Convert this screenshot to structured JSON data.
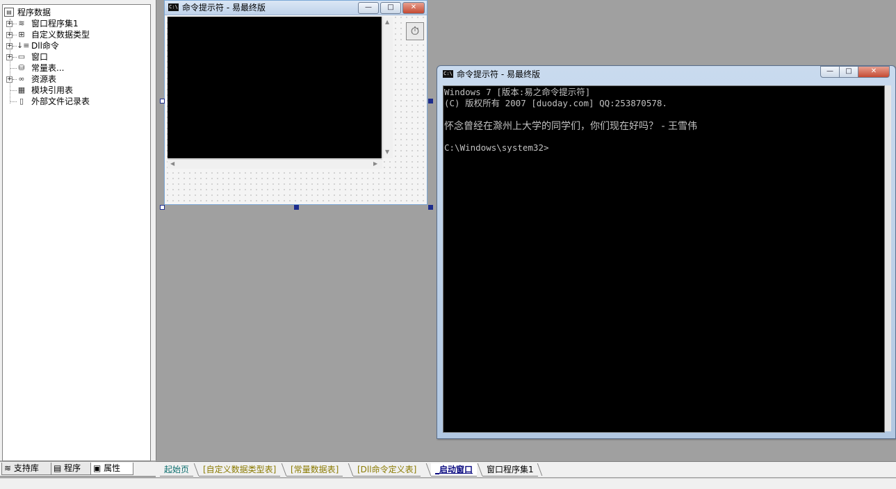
{
  "tree": {
    "root": "程序数据",
    "items": [
      {
        "label": "窗口程序集1",
        "icon": "stack-icon",
        "expandable": true
      },
      {
        "label": "自定义数据类型",
        "icon": "datatype-icon",
        "expandable": true
      },
      {
        "label": "Dll命令",
        "icon": "dll-icon",
        "expandable": true
      },
      {
        "label": "窗口",
        "icon": "window-icon",
        "expandable": true
      },
      {
        "label": "常量表...",
        "icon": "database-icon",
        "expandable": false
      },
      {
        "label": "资源表",
        "icon": "resource-icon",
        "expandable": true
      },
      {
        "label": "模块引用表",
        "icon": "module-icon",
        "expandable": false
      },
      {
        "label": "外部文件记录表",
        "icon": "file-icon",
        "expandable": false
      }
    ]
  },
  "left_tabs": [
    {
      "label": "支持库",
      "icon": "library-icon"
    },
    {
      "label": "程序",
      "icon": "program-icon"
    },
    {
      "label": "属性",
      "icon": "properties-icon"
    }
  ],
  "design_window": {
    "title": "命令提示符 - 易最终版",
    "icon_text": "C:\\",
    "minimize": "—",
    "maximize": "□",
    "close": "✕"
  },
  "run_window": {
    "title": "命令提示符 - 易最终版",
    "icon_text": "C:\\",
    "minimize": "—",
    "maximize": "□",
    "close": "✕",
    "console_lines": [
      "Windows 7 [版本:易之命令提示符]",
      "(C) 版权所有 2007 [duoday.com] QQ:253870578.",
      "",
      "怀念曾经在滁州上大学的同学们，你们现在好吗？ - 王雪伟",
      "",
      "C:\\Windows\\system32>"
    ]
  },
  "doc_tabs": [
    {
      "label": "起始页",
      "style": "link"
    },
    {
      "label": "[自定义数据类型表]",
      "style": "yellow"
    },
    {
      "label": "[常量数据表]",
      "style": "yellow"
    },
    {
      "label": "[Dll命令定义表]",
      "style": "yellow"
    },
    {
      "label": "_启动窗口",
      "style": "active"
    },
    {
      "label": "窗口程序集1",
      "style": "plain"
    }
  ],
  "colors": {
    "console_bg": "#000000",
    "console_text": "#c0c0c0",
    "workspace_bg": "#a0a0a0",
    "active_tab": "#0a0a80"
  }
}
